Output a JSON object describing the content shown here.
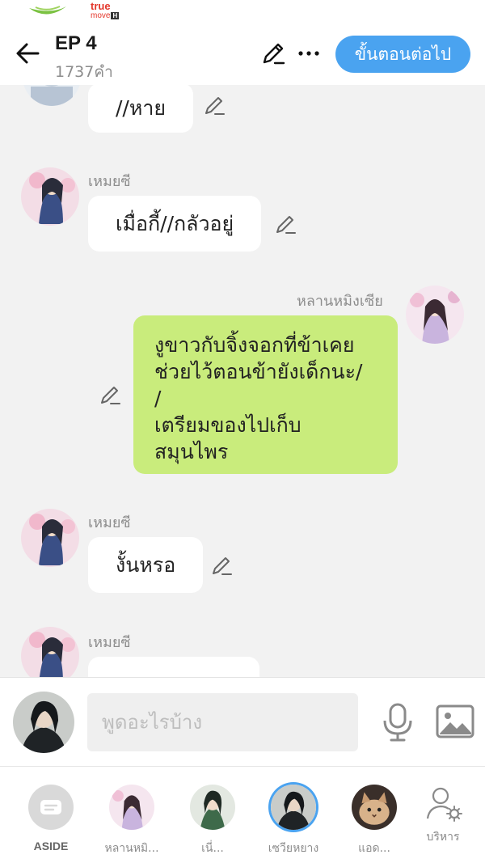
{
  "status": {
    "carrier_true": "true",
    "carrier_move": "move",
    "carrier_h": "H"
  },
  "header": {
    "title": "EP 4",
    "word_count": "1737คำ",
    "next_label": "ขั้นตอนต่อไป"
  },
  "messages": [
    {
      "speaker": "",
      "text": "//หาย",
      "side": "left"
    },
    {
      "speaker": "เหมยซี",
      "text": "เมื่อกี้//กลัวอยู่",
      "side": "left"
    },
    {
      "speaker": "หลานหมิงเซีย",
      "lines": [
        "งูขาวกับจิ้งจอกที่ข้าเคย",
        "ช่วยไว้ตอนข้ายังเด็กนะ/",
        "/",
        "เตรียมของไปเก็บ",
        "สมุนไพร"
      ],
      "side": "right"
    },
    {
      "speaker": "เหมยซี",
      "text": "งั้นหรอ",
      "side": "left"
    },
    {
      "speaker": "เหมยซี",
      "text": "",
      "side": "left"
    }
  ],
  "composer": {
    "placeholder": "พูดอะไรบ้าง"
  },
  "cast": [
    {
      "label": "ASIDE"
    },
    {
      "label": "หลานหมิ..."
    },
    {
      "label": "เนี่..."
    },
    {
      "label": "เซวียหยาง",
      "selected": true
    },
    {
      "label": "แอด..."
    },
    {
      "label": "บริหาร"
    }
  ],
  "colors": {
    "accent": "#4aa3f0",
    "right_bubble": "#c9ec7c",
    "background": "#f2f2f2"
  }
}
